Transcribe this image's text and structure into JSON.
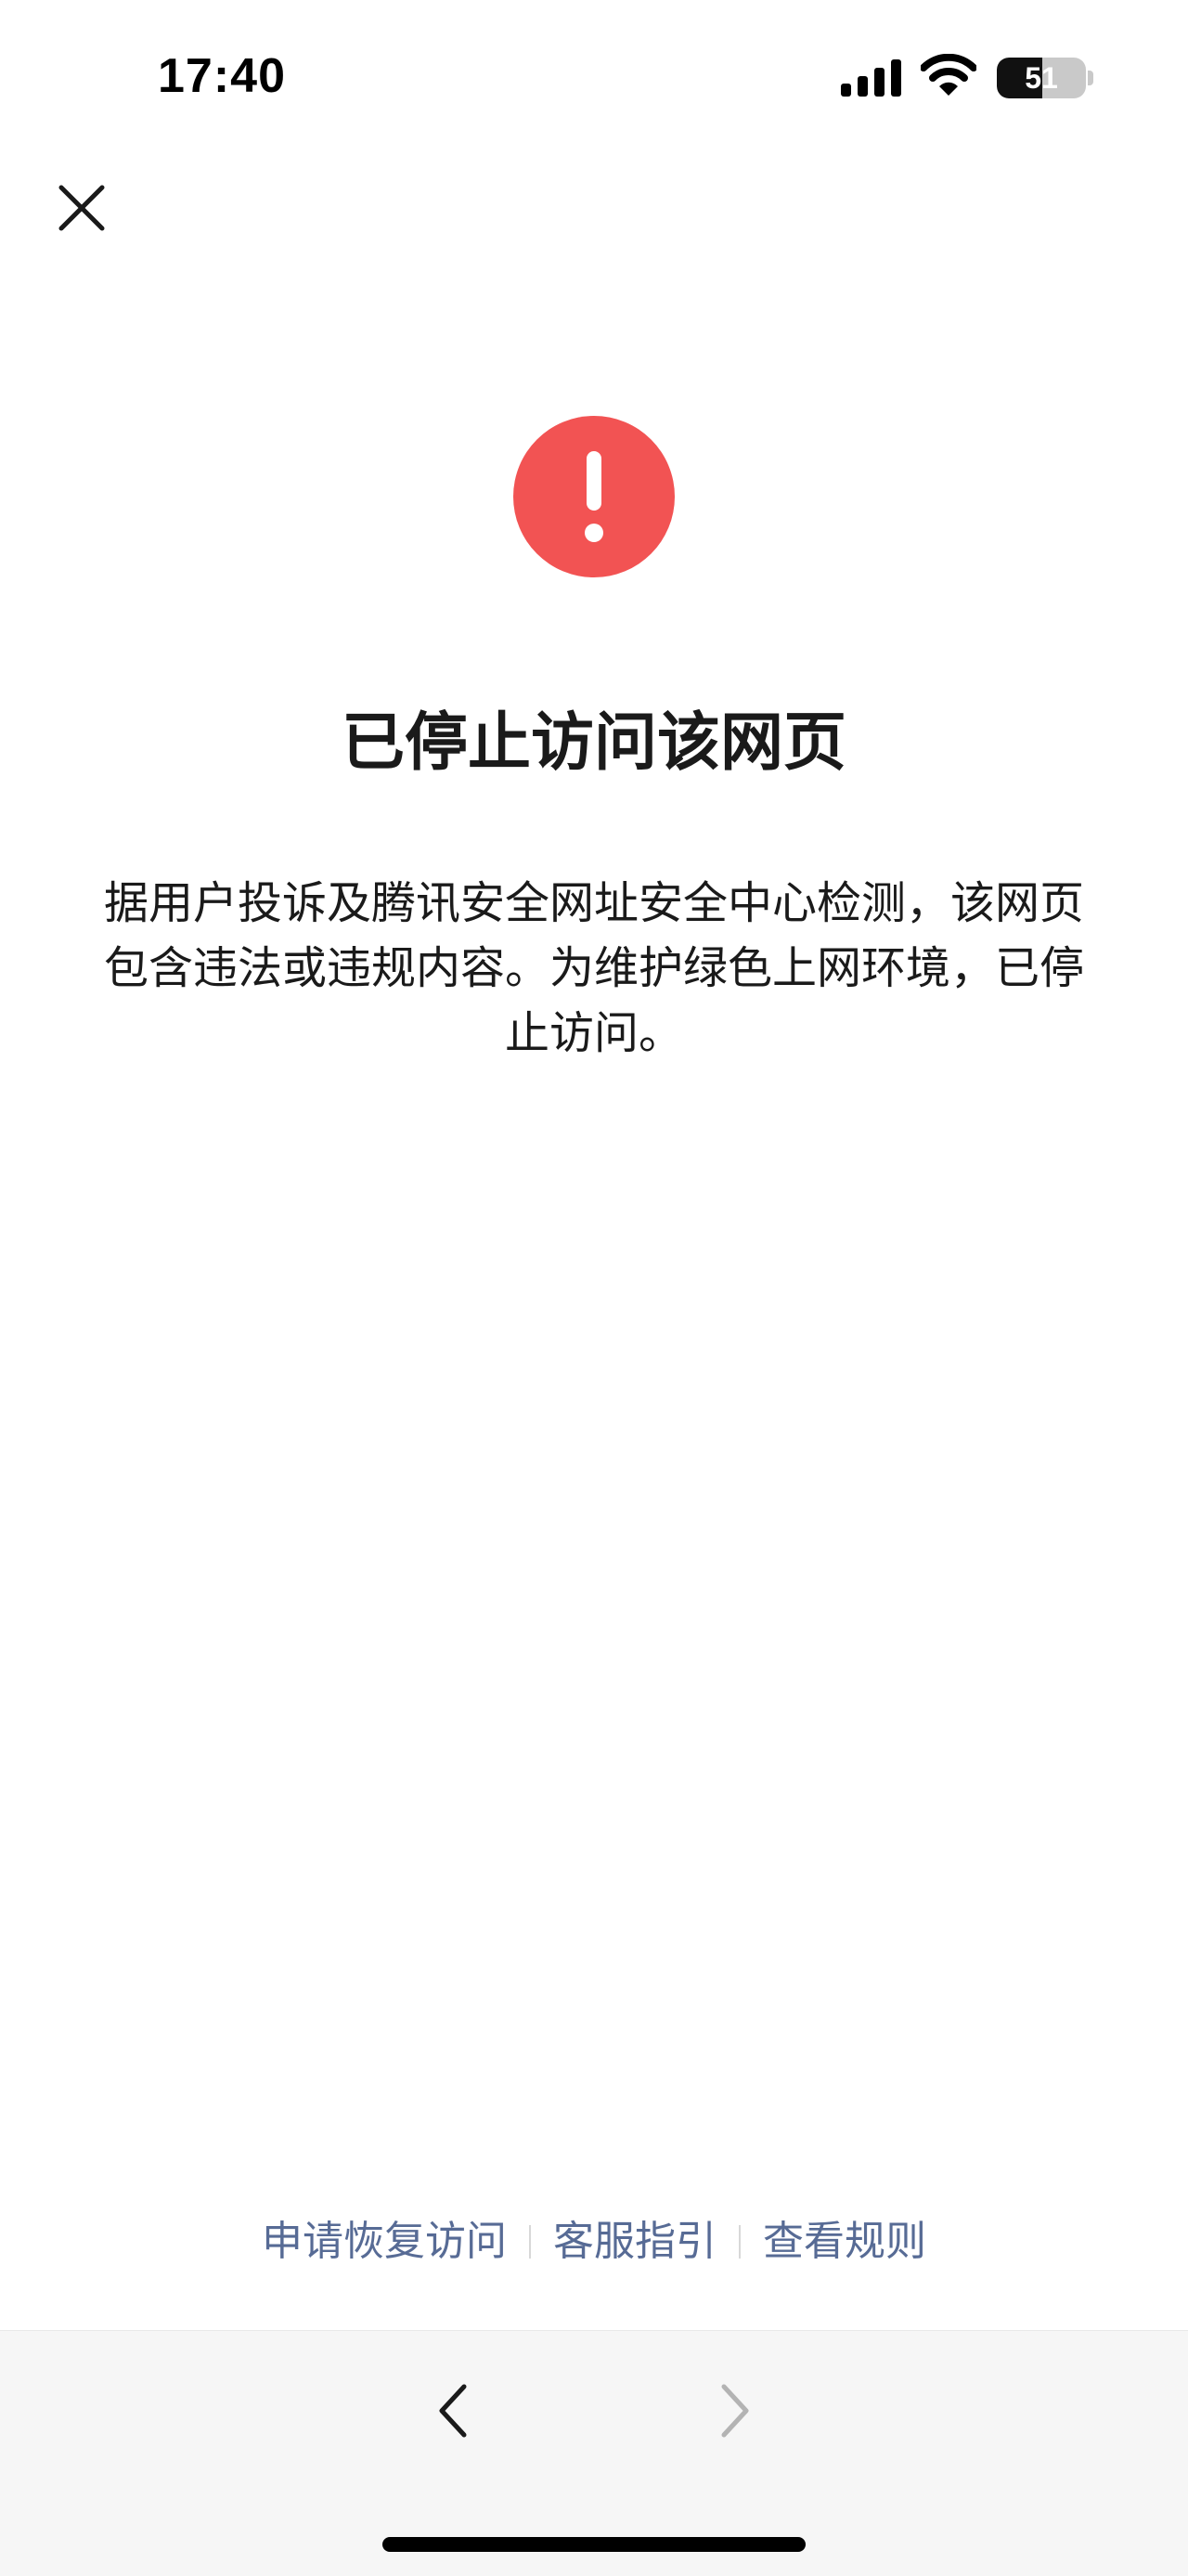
{
  "status_bar": {
    "time": "17:40",
    "battery_level": "51",
    "battery_fraction": 0.51
  },
  "header": {
    "close_icon": "close-icon"
  },
  "main": {
    "alert_icon": "exclamation-circle-icon",
    "alert_color": "#f25353",
    "title": "已停止访问该网页",
    "message": "据用户投诉及腾讯安全网址安全中心检测，该网页包含违法或违规内容。为维护绿色上网环境，已停止访问。"
  },
  "footer": {
    "links": [
      "申请恢复访问",
      "客服指引",
      "查看规则"
    ],
    "link_color": "#576b95"
  },
  "toolbar": {
    "back_icon": "chevron-left-icon",
    "forward_icon": "chevron-right-icon"
  }
}
